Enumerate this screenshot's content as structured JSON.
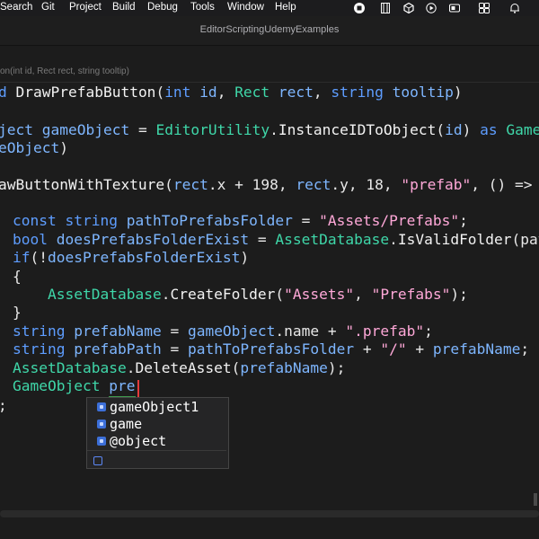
{
  "menubar": {
    "items": [
      "Search",
      "Git",
      "Project",
      "Build",
      "Debug",
      "Tools",
      "Window",
      "Help"
    ],
    "icons": [
      "stop-icon",
      "film-icon",
      "unity-icon",
      "play-icon",
      "window-icon",
      "control-center-icon",
      "bell-icon"
    ]
  },
  "window": {
    "title": "EditorScriptingUdemyExamples"
  },
  "editor": {
    "signature_hint": "on(int id, Rect rect, string tooltip)",
    "lines": [
      "d DrawPrefabButton(int id, Rect rect, string tooltip)",
      "ject gameObject = EditorUtility.InstanceIDToObject(id) as GameO",
      "eObject)",
      "awButtonWithTexture(rect.x + 198, rect.y, 18, \"prefab\", () =>",
      "const string pathToPrefabsFolder = \"Assets/Prefabs\";",
      "bool doesPrefabsFolderExist = AssetDatabase.IsValidFolder(pat",
      "if(!doesPrefabsFolderExist)",
      "{",
      "AssetDatabase.CreateFolder(\"Assets\", \"Prefabs\");",
      "}",
      "string prefabName = gameObject.name + \".prefab\";",
      "string prefabPath = pathToPrefabsFolder + \"/\" + prefabName;",
      "AssetDatabase.DeleteAsset(prefabName);",
      "GameObject pre"
    ],
    "trailing": ";"
  },
  "autocomplete": {
    "items": [
      "gameObject1",
      "game",
      "@object"
    ],
    "item_icon": "symbol-variable-icon",
    "footer_icon": "symbol-filter-icon"
  },
  "colors": {
    "keyword": "#5e9dff",
    "type": "#3fd7a9",
    "string": "#ffa8d8",
    "identifier": "#7eb6ff",
    "caret": "#e23b3b"
  }
}
